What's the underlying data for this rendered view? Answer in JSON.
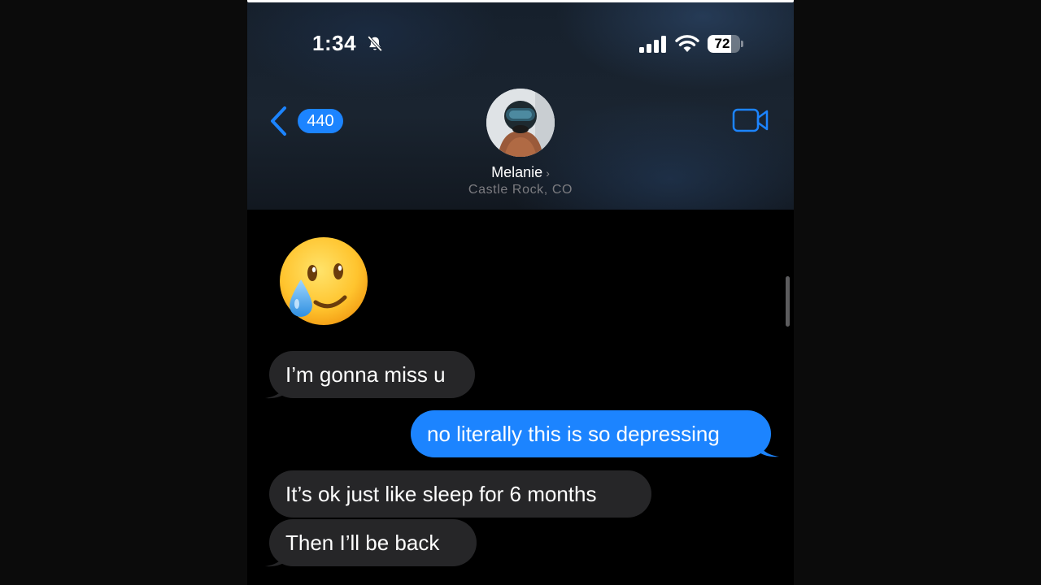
{
  "status_bar": {
    "time": "1:34",
    "battery_level": "72",
    "battery_fraction": 0.72
  },
  "nav": {
    "back_count": "440"
  },
  "contact": {
    "name": "Melanie",
    "location": "Castle Rock, CO"
  },
  "messages": [
    {
      "from": "them",
      "text": "I’m gonna miss u"
    },
    {
      "from": "me",
      "text": "no literally this is so depressing"
    },
    {
      "from": "them",
      "text": "It’s ok just like sleep for 6 months"
    },
    {
      "from": "them",
      "text": "Then I’ll be back"
    }
  ],
  "colors": {
    "accent": "#1c84ff",
    "incoming_bubble": "#262628",
    "outgoing_bubble": "#1c84ff"
  },
  "icons": [
    "chevron-left-icon",
    "bell-slash-icon",
    "cellular-signal-icon",
    "wifi-icon",
    "battery-icon",
    "video-camera-icon",
    "face-holding-back-tears-emoji"
  ]
}
